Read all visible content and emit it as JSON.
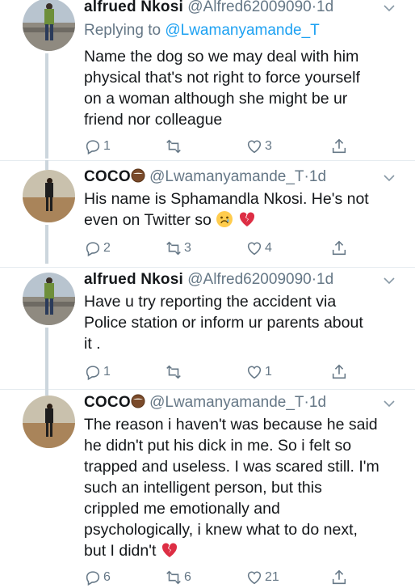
{
  "tweets": [
    {
      "name": "alfrued Nkosi",
      "handle": "@Alfred62009090",
      "dot": "·",
      "time": "1d",
      "reply_prefix": "Replying to",
      "reply_to": "@Lwamanyamande_T",
      "text_lines": [
        "Name the dog so we may deal with him",
        "physical that's not right to force yourself",
        "on a woman although she might be ur",
        "friend nor colleague"
      ],
      "replies": "1",
      "retweets": "",
      "likes": "3"
    },
    {
      "name": "COCO",
      "handle": "@Lwamanyamande_T",
      "dot": "·",
      "time": "1d",
      "text_lines": [
        "His name is Sphamandla Nkosi. He's not",
        "even on Twitter so"
      ],
      "replies": "2",
      "retweets": "3",
      "likes": "4"
    },
    {
      "name": "alfrued Nkosi",
      "handle": "@Alfred62009090",
      "dot": "·",
      "time": "1d",
      "text_lines": [
        "Have u try reporting the accident via",
        "Police station or inform ur parents about",
        "it ."
      ],
      "replies": "1",
      "retweets": "",
      "likes": "1"
    },
    {
      "name": "COCO",
      "handle": "@Lwamanyamande_T",
      "dot": "·",
      "time": "1d",
      "text_lines": [
        "The reason i haven't was because he said",
        "he didn't put his dick in me. So i felt so",
        "trapped and useless. I was scared still. I'm",
        "such an intelligent person, but this",
        "crippled me emotionally and",
        "psychologically, i knew what to do next,",
        "but I didn't"
      ],
      "replies": "6",
      "retweets": "6",
      "likes": "21"
    }
  ],
  "icons": {
    "reply": "reply-icon",
    "retweet": "retweet-icon",
    "like": "heart-icon",
    "share": "share-icon",
    "more": "chevron-down-icon"
  },
  "colors": {
    "text": "#14171a",
    "muted": "#657786",
    "link": "#1da1f2",
    "thread": "#ccd6dd"
  }
}
